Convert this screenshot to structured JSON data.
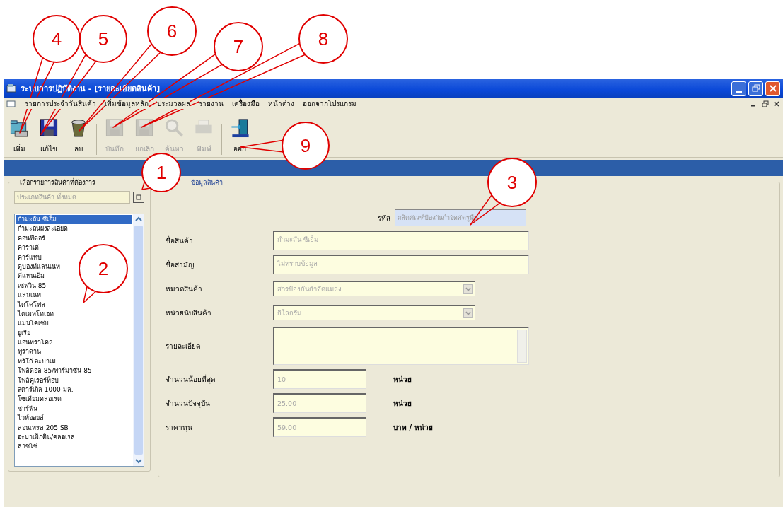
{
  "window": {
    "title": "ระบบการปฏิบัติงาน - [รายละเอียดสินค้า]"
  },
  "menu": [
    {
      "label": "รายการประจำวันสินค้า"
    },
    {
      "label": "เพิ่มข้อมูลหลัก"
    },
    {
      "label": "ประมวลผล"
    },
    {
      "label": "รายงาน"
    },
    {
      "label": "เครื่องมือ"
    },
    {
      "label": "หน้าต่าง"
    },
    {
      "label": "ออกจากโปรแกรม"
    }
  ],
  "toolbar": [
    {
      "kind": "add",
      "label": "เพิ่ม",
      "disabled": false
    },
    {
      "kind": "edit",
      "label": "แก้ไข",
      "disabled": false
    },
    {
      "kind": "delete",
      "label": "ลบ",
      "disabled": false
    },
    {
      "kind": "save",
      "label": "บันทึก",
      "disabled": true
    },
    {
      "kind": "cancel",
      "label": "ยกเลิก",
      "disabled": true
    },
    {
      "kind": "search",
      "label": "ค้นหา",
      "disabled": true
    },
    {
      "kind": "print",
      "label": "พิมพ์",
      "disabled": true
    },
    {
      "kind": "exit",
      "label": "ออก",
      "disabled": false
    }
  ],
  "product_list": {
    "title": "เลือกรายการสินค้าที่ต้องการ",
    "filter_value": "ประเภทสินค้า ทั้งหมด",
    "items": [
      {
        "label": "กำมะถัน ซีเอ็ม",
        "selected": true
      },
      {
        "label": "กำมะถันผงละเอียด",
        "selected": false
      },
      {
        "label": "คอนฟิดอร์",
        "selected": false
      },
      {
        "label": "คาราเต้",
        "selected": false
      },
      {
        "label": "คาร์แทป",
        "selected": false
      },
      {
        "label": "ดูปองท์แลนเนท",
        "selected": false
      },
      {
        "label": "ดีแทนเอ็ม",
        "selected": false
      },
      {
        "label": "เซฟวิน 85",
        "selected": false
      },
      {
        "label": "แลนเนท",
        "selected": false
      },
      {
        "label": "ไดโคโฟล",
        "selected": false
      },
      {
        "label": "ไดเมทโทเอท",
        "selected": false
      },
      {
        "label": "แมนโคเซบ",
        "selected": false
      },
      {
        "label": "ยูเรีย",
        "selected": false
      },
      {
        "label": "แอนทราโคล",
        "selected": false
      },
      {
        "label": "ฟูราดาน",
        "selected": false
      },
      {
        "label": "ทริโก้ อะบาเม",
        "selected": false
      },
      {
        "label": "โฟลิดอล 85/ฟาร์มาซีน 85",
        "selected": false
      },
      {
        "label": "โฟลิคูเรอร์ท็อป",
        "selected": false
      },
      {
        "label": "สตาร์เกิล 1000 มล.",
        "selected": false
      },
      {
        "label": "โซเดียมคลอเรต",
        "selected": false
      },
      {
        "label": "ซาร์ฟีน",
        "selected": false
      },
      {
        "label": "ไวท์ออยล์",
        "selected": false
      },
      {
        "label": "ลอนเทรล 205 SB",
        "selected": false
      },
      {
        "label": "อะบาเม็กติน/คลอเรล",
        "selected": false
      },
      {
        "label": "ลาซโซ่",
        "selected": false
      }
    ]
  },
  "details": {
    "title": "ข้อมูลสินค้า",
    "code_label": "รหัส",
    "code_value": "ผลิตภัณฑ์ป้องกันกำจัดศัตรูพืช",
    "fields": [
      {
        "kind": "text",
        "label": "ชื่อสินค้า",
        "value": "กำมะถัน ซีเอ็ม",
        "disabled": true
      },
      {
        "kind": "text",
        "label": "ชื่อสามัญ",
        "value": "ไม่ทราบข้อมูล",
        "disabled": true
      },
      {
        "kind": "select",
        "label": "หมวดสินค้า",
        "value": "สารป้องกันกำจัดแมลง",
        "disabled": true
      },
      {
        "kind": "select",
        "label": "หน่วยนับสินค้า",
        "value": "กิโลกรัม",
        "disabled": true
      },
      {
        "kind": "textarea",
        "label": "รายละเอียด",
        "disabled": true
      },
      {
        "kind": "number",
        "label": "จำนวนน้อยที่สุด",
        "value": "10",
        "unit": "หน่วย",
        "disabled": true
      },
      {
        "kind": "number",
        "label": "จำนวนปัจจุบัน",
        "value": "25.00",
        "unit": "หน่วย",
        "disabled": true
      },
      {
        "kind": "number",
        "label": "ราคาทุน",
        "value": "59.00",
        "unit": "บาท / หน่วย",
        "disabled": true
      }
    ]
  },
  "callouts": [
    {
      "number": "4"
    },
    {
      "number": "5"
    },
    {
      "number": "6"
    },
    {
      "number": "7"
    },
    {
      "number": "8"
    },
    {
      "number": "1"
    },
    {
      "number": "9"
    },
    {
      "number": "3"
    },
    {
      "number": "2"
    }
  ]
}
